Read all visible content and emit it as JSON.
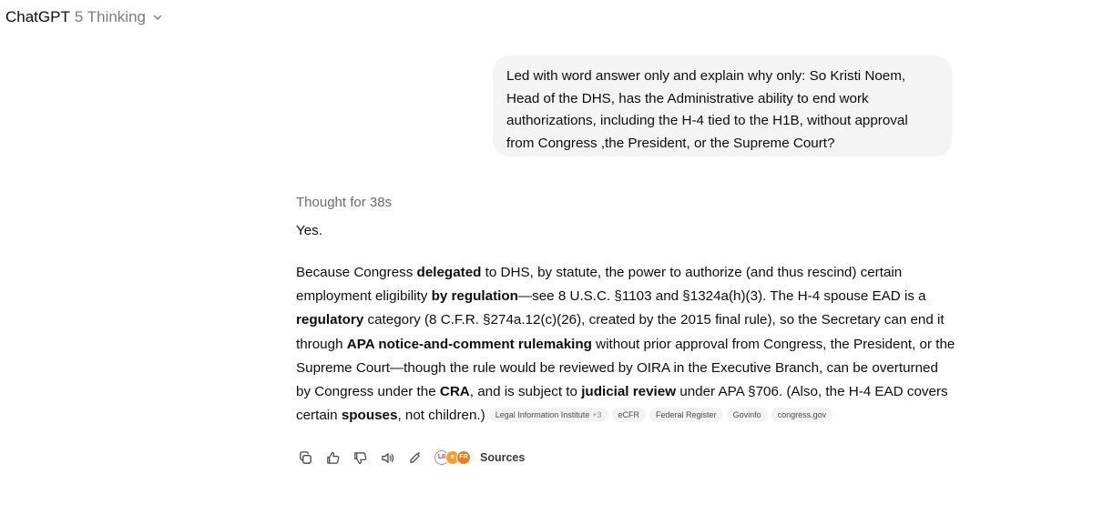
{
  "header": {
    "app_name": "ChatGPT",
    "model_name": "5 Thinking"
  },
  "user_message": {
    "text": "Led with word answer only and explain why only: So Kristi Noem, Head of the DHS, has the Administrative ability to end work authorizations, including the H-4 tied to the H1B, without approval from Congress ,the President, or the Supreme Court?"
  },
  "assistant": {
    "thought_label": "Thought for 38s",
    "short_answer": "Yes.",
    "body": [
      {
        "t": "Because Congress "
      },
      {
        "t": "delegated",
        "b": true
      },
      {
        "t": " to DHS, by statute, the power to authorize (and thus rescind) certain employment eligibility "
      },
      {
        "t": "by regulation",
        "b": true
      },
      {
        "t": "—see 8 U.S.C. §1103 and §1324a(h)(3). The H-4 spouse EAD is a "
      },
      {
        "t": "regulatory",
        "b": true
      },
      {
        "t": " category (8 C.F.R. §274a.12(c)(26), created by the 2015 final rule), so the Secretary can end it through "
      },
      {
        "t": "APA notice-and-comment rulemaking",
        "b": true
      },
      {
        "t": " without prior approval from Congress, the President, or the Supreme Court—though the rule would be reviewed by OIRA in the Executive Branch, can be overturned by Congress under the "
      },
      {
        "t": "CRA",
        "b": true
      },
      {
        "t": ", and is subject to "
      },
      {
        "t": "judicial review",
        "b": true
      },
      {
        "t": " under APA §706. (Also, the H-4 EAD covers certain "
      },
      {
        "t": "spouses",
        "b": true
      },
      {
        "t": ", not children.)"
      }
    ],
    "citations": [
      {
        "label": "Legal Information Institute",
        "extra": "+3"
      },
      {
        "label": "eCFR"
      },
      {
        "label": "Federal Register"
      },
      {
        "label": "Govinfo"
      },
      {
        "label": "congress.gov"
      }
    ]
  },
  "actions": {
    "copy_icon": "copy-icon",
    "thumbs_up_icon": "thumbs-up-icon",
    "thumbs_down_icon": "thumbs-down-icon",
    "read_aloud_icon": "speaker-icon",
    "edit_icon": "edit-icon",
    "source_favicons": [
      "LII",
      "e",
      "FR"
    ],
    "sources_label": "Sources"
  },
  "colors": {
    "bubble_bg": "#f4f4f4",
    "muted_text": "#7d7d7d",
    "chip_bg": "#f3f3f3"
  }
}
